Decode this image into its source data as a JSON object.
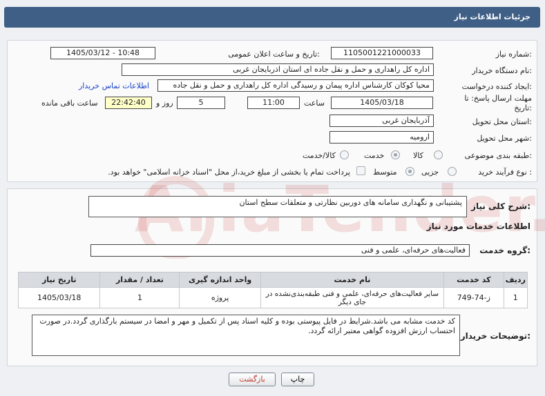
{
  "header": {
    "title": "جزئیات اطلاعات نیاز"
  },
  "form": {
    "need_number_label": "شماره نیاز:",
    "need_number": "1105001221000033",
    "announce_label": "تاریخ و ساعت اعلان عمومی:",
    "announce_value": "1405/03/12 - 10:48",
    "buyer_org_label": "نام دستگاه خریدار:",
    "buyer_org": "اداره کل راهداری و حمل و نقل جاده ای استان اذربایجان غربی",
    "creator_label": "ایجاد کننده درخواست:",
    "creator": "محیا کوکان کارشناس اداره پیمان و رسیدگی اداره کل راهداری و حمل و نقل جاده",
    "contact_link": "اطلاعات تماس خریدار",
    "deadline_label": "مهلت ارسال پاسخ: تا تاریخ:",
    "deadline_date": "1405/03/18",
    "time_label": "ساعت",
    "deadline_time": "11:00",
    "days_value": "5",
    "days_label": "روز و",
    "remaining_time": "22:42:40",
    "remaining_label": "ساعت باقی مانده",
    "province_label": "استان محل تحویل:",
    "province": "آذربایجان غربی",
    "city_label": "شهر محل تحویل:",
    "city": "ارومیه",
    "category_label": "طبقه بندی موضوعی:",
    "category_options": [
      "کالا",
      "خدمت",
      "کالا/خدمت"
    ],
    "process_label": "نوع فرآیند خرید :",
    "process_options": [
      "جزیی",
      "متوسط"
    ],
    "payment_note": "پرداخت تمام یا بخشی از مبلغ خرید،از محل \"اسناد خزانه اسلامی\" خواهد بود."
  },
  "details": {
    "summary_label": "شرح کلی نیاز:",
    "summary": "پشتیبانی و نگهداری سامانه های دوربین نظارتی و متعلقات سطح استان",
    "services_heading": "اطلاعات خدمات مورد نیاز",
    "group_label": "گروه خدمت:",
    "group_value": "فعالیت‌های حرفه‌ای، علمی و فنی",
    "table": {
      "headers": [
        "ردیف",
        "کد خدمت",
        "نام خدمت",
        "واحد اندازه گیری",
        "تعداد / مقدار",
        "تاریخ نیاز"
      ],
      "rows": [
        [
          "1",
          "ز-74-749",
          "سایر فعالیت‌های حرفه‌ای، علمی و فنی طبقه‌بندی‌نشده در جای دیگر",
          "پروژه",
          "1",
          "1405/03/18"
        ]
      ]
    },
    "buyer_notes_label": "توضیحات خریدار:",
    "buyer_notes": "کد خدمت مشابه می باشد.شرایط در فایل پیوستی بوده و کلیه اسناد پس از تکمیل و مهر و امضا در سیستم بارگذاری گردد.در صورت احتساب ارزش افزوده گواهی معتبر ارائه گردد."
  },
  "buttons": {
    "print": "چاپ",
    "back": "بازگشت"
  },
  "watermark": "AriaTender.net",
  "colors": {
    "header_bg": "#3f5f86",
    "link": "#1a44c8",
    "highlight": "#ffffc8",
    "back_text": "#c0392b"
  }
}
